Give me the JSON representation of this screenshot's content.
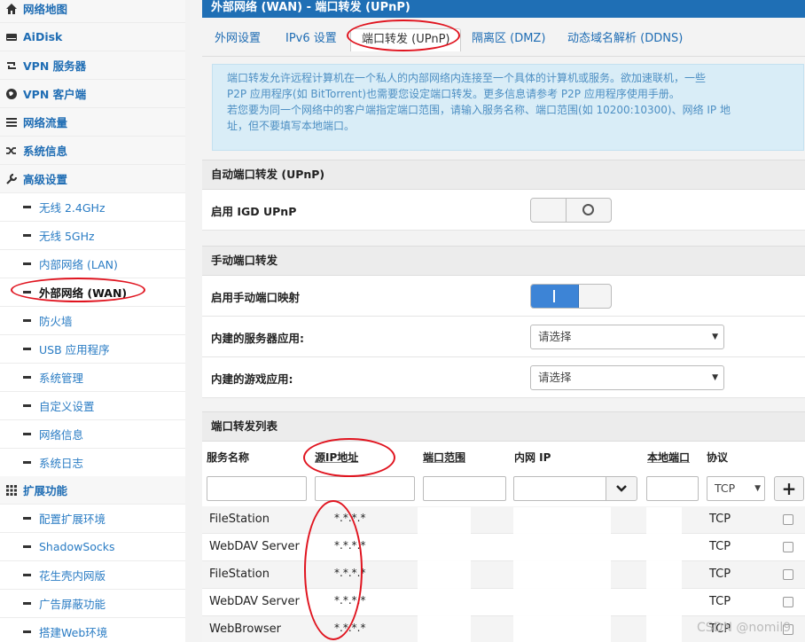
{
  "sidebar": {
    "items": [
      {
        "label": "网络地图",
        "icon": "home-icon",
        "level": "top"
      },
      {
        "label": "AiDisk",
        "icon": "hdd-icon",
        "level": "top"
      },
      {
        "label": "VPN 服务器",
        "icon": "retweet-icon",
        "level": "top"
      },
      {
        "label": "VPN 客户端",
        "icon": "globe-icon",
        "level": "top"
      },
      {
        "label": "网络流量",
        "icon": "list-icon",
        "level": "top"
      },
      {
        "label": "系统信息",
        "icon": "random-icon",
        "level": "top"
      },
      {
        "label": "高级设置",
        "icon": "wrench-icon",
        "level": "top"
      },
      {
        "label": "无线 2.4GHz",
        "level": "sub"
      },
      {
        "label": "无线 5GHz",
        "level": "sub"
      },
      {
        "label": "内部网络 (LAN)",
        "level": "sub"
      },
      {
        "label": "外部网络 (WAN)",
        "level": "sub",
        "active": true
      },
      {
        "label": "防火墙",
        "level": "sub"
      },
      {
        "label": "USB 应用程序",
        "level": "sub"
      },
      {
        "label": "系统管理",
        "level": "sub"
      },
      {
        "label": "自定义设置",
        "level": "sub"
      },
      {
        "label": "网络信息",
        "level": "sub"
      },
      {
        "label": "系统日志",
        "level": "sub"
      },
      {
        "label": "扩展功能",
        "icon": "grid-icon",
        "level": "top"
      },
      {
        "label": "配置扩展环境",
        "level": "sub"
      },
      {
        "label": "ShadowSocks",
        "level": "sub"
      },
      {
        "label": "花生壳内网版",
        "level": "sub"
      },
      {
        "label": "广告屏蔽功能",
        "level": "sub"
      },
      {
        "label": "搭建Web环境",
        "level": "sub"
      }
    ]
  },
  "header": {
    "title": "外部网络 (WAN) - 端口转发 (UPnP)"
  },
  "tabs": [
    {
      "label": "外网设置"
    },
    {
      "label": "IPv6 设置"
    },
    {
      "label": "端口转发 (UPnP)",
      "active": true
    },
    {
      "label": "隔离区 (DMZ)"
    },
    {
      "label": "动态域名解析 (DDNS)"
    }
  ],
  "info": {
    "line1": "端口转发允许远程计算机在一个私人的内部网络内连接至一个具体的计算机或服务。欲加速联机，一些",
    "line2": "P2P 应用程序(如 BitTorrent)也需要您设定端口转发。更多信息请参考 P2P 应用程序使用手册。",
    "line3": "若您要为同一个网络中的客户端指定端口范围，请输入服务名称、端口范围(如 10200:10300)、网络 IP 地",
    "line4": "址，但不要填写本地端口。"
  },
  "upnp": {
    "section": "自动端口转发 (UPnP)",
    "igd_label": "启用 IGD UPnP",
    "igd_on": false
  },
  "manual": {
    "section": "手动端口转发",
    "enable_label": "启用手动端口映射",
    "enable_on": true,
    "server_label": "内建的服务器应用:",
    "server_value": "请选择",
    "game_label": "内建的游戏应用:",
    "game_value": "请选择"
  },
  "table": {
    "section": "端口转发列表",
    "headers": {
      "name": "服务名称",
      "src_ip": "源IP地址",
      "port_range": "端口范围",
      "lan_ip": "内网 IP",
      "local_port": "本地端口",
      "protocol": "协议"
    },
    "new_protocol": "TCP",
    "add_label": "+",
    "rows": [
      {
        "name": "FileStation",
        "src": "*.*.*.*",
        "protocol": "TCP"
      },
      {
        "name": "WebDAV Server",
        "src": "*.*.*.*",
        "protocol": "TCP"
      },
      {
        "name": "FileStation",
        "src": "*.*.*.*",
        "protocol": "TCP"
      },
      {
        "name": "WebDAV Server",
        "src": "*.*.*.*",
        "protocol": "TCP"
      },
      {
        "name": "WebBrowser",
        "src": "*.*.*.*",
        "protocol": "TCP"
      }
    ]
  },
  "watermark": "CSDN @nomil9",
  "colors": {
    "brand": "#1f6fb5",
    "link": "#2a7cc4",
    "annotation": "#e0141f"
  }
}
